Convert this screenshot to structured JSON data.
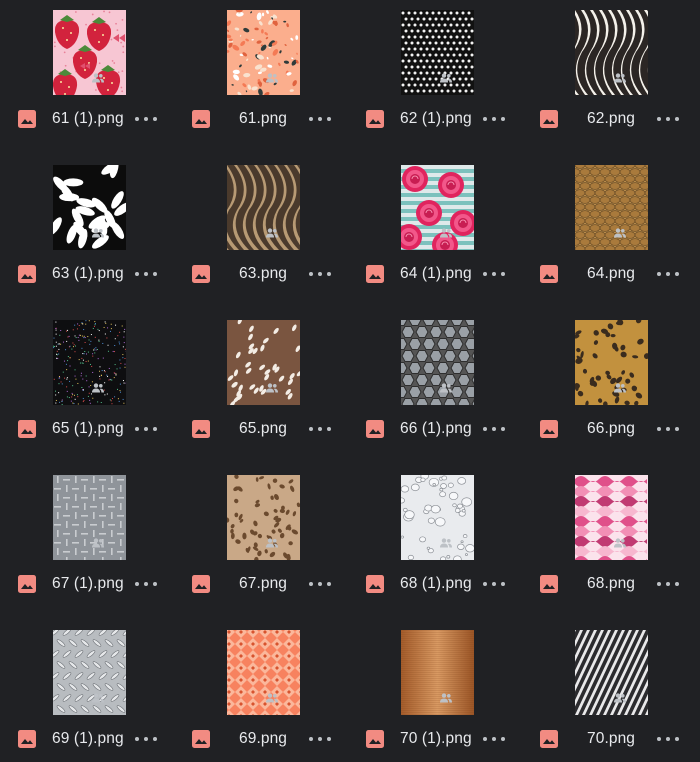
{
  "files": [
    {
      "name": "61 (1).png",
      "pattern": "strawberry"
    },
    {
      "name": "61.png",
      "pattern": "terrazzo"
    },
    {
      "name": "62 (1).png",
      "pattern": "polkadot"
    },
    {
      "name": "62.png",
      "pattern": "zebra"
    },
    {
      "name": "63 (1).png",
      "pattern": "leaves"
    },
    {
      "name": "63.png",
      "pattern": "tiger"
    },
    {
      "name": "64 (1).png",
      "pattern": "roses"
    },
    {
      "name": "64.png",
      "pattern": "snakeskin"
    },
    {
      "name": "65 (1).png",
      "pattern": "glitter"
    },
    {
      "name": "65.png",
      "pattern": "deer"
    },
    {
      "name": "66 (1).png",
      "pattern": "hexmetal"
    },
    {
      "name": "66.png",
      "pattern": "cheetah"
    },
    {
      "name": "67 (1).png",
      "pattern": "diamondplate"
    },
    {
      "name": "67.png",
      "pattern": "leopard"
    },
    {
      "name": "68 (1).png",
      "pattern": "waterdrops"
    },
    {
      "name": "68.png",
      "pattern": "pinkwaves"
    },
    {
      "name": "69 (1).png",
      "pattern": "treadplate"
    },
    {
      "name": "69.png",
      "pattern": "orangegeo"
    },
    {
      "name": "70 (1).png",
      "pattern": "copper"
    },
    {
      "name": "70.png",
      "pattern": "diagonalstripes"
    }
  ],
  "icons": {
    "file_type": "image-file-icon",
    "shared": "shared-people-icon",
    "more": "more-options-icon"
  },
  "colors": {
    "background": "#202124",
    "file_icon": "#f28b82",
    "text": "#e8eaed",
    "secondary": "#bdc1c6"
  }
}
